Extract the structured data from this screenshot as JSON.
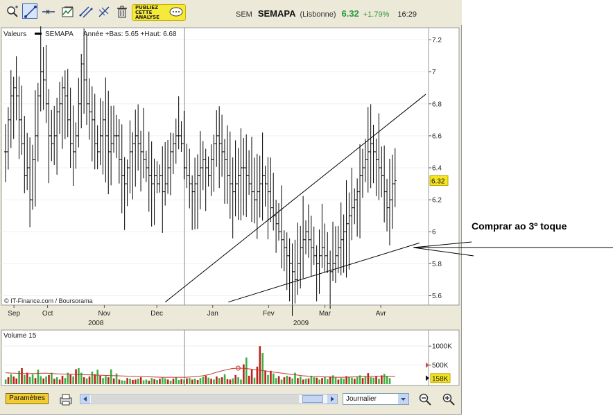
{
  "toolbar": {
    "tools": [
      {
        "name": "zoom-icon"
      },
      {
        "name": "trendline-icon"
      },
      {
        "name": "horizontal-line-icon"
      },
      {
        "name": "indicator-icon"
      },
      {
        "name": "channel-icon"
      },
      {
        "name": "fibonacci-icon"
      },
      {
        "name": "trash-icon"
      }
    ],
    "ad_text": "PUBLIEZ\nCETTE\nANALYSE"
  },
  "quote": {
    "market": "SEM",
    "name": "SEMAPA",
    "place": "(Lisbonne)",
    "price": "6.32",
    "change": "+1.79%",
    "time": "16:29"
  },
  "chart_data": [
    {
      "type": "ohlc",
      "header_label": "Valeurs",
      "legend_series": "SEMAPA",
      "legend_range": "Année +Bas: 5.65 +Haut: 6.68",
      "source": "© IT-Finance.com / Boursorama",
      "ylim": [
        5.55,
        7.25
      ],
      "yticks": [
        "5.6",
        "5.8",
        "6",
        "6.2",
        "6.4",
        "6.6",
        "6.8",
        "7",
        "7.2"
      ],
      "month_labels": [
        {
          "label": "Sep",
          "pos": 0.02
        },
        {
          "label": "Oct",
          "pos": 0.1
        },
        {
          "label": "Nov",
          "pos": 0.235
        },
        {
          "label": "Dec",
          "pos": 0.36
        },
        {
          "label": "Jan",
          "pos": 0.493
        },
        {
          "label": "Fev",
          "pos": 0.626
        },
        {
          "label": "Mar",
          "pos": 0.76
        },
        {
          "label": "Avr",
          "pos": 0.893
        }
      ],
      "year_labels": [
        {
          "label": "2008",
          "pos": 0.215
        },
        {
          "label": "2009",
          "pos": 0.703
        }
      ],
      "year_separator_pos": 0.426,
      "last_value_label": "6.32",
      "series_close": [
        6.5,
        6.7,
        6.85,
        6.9,
        6.85,
        6.7,
        6.55,
        6.35,
        6.4,
        6.2,
        6.45,
        6.6,
        6.85,
        7.0,
        6.95,
        6.8,
        6.6,
        6.55,
        6.6,
        6.75,
        6.8,
        6.9,
        6.85,
        6.7,
        6.55,
        6.5,
        6.6,
        6.8,
        7.05,
        6.95,
        6.8,
        6.75,
        6.7,
        6.55,
        6.5,
        6.6,
        6.7,
        6.6,
        6.5,
        6.55,
        6.6,
        6.6,
        6.45,
        6.35,
        6.3,
        6.4,
        6.5,
        6.55,
        6.6,
        6.55,
        6.5,
        6.45,
        6.4,
        6.35,
        6.3,
        6.35,
        6.3,
        6.35,
        6.25,
        6.3,
        6.4,
        6.5,
        6.55,
        6.6,
        6.6,
        6.55,
        6.4,
        6.35,
        6.3,
        6.25,
        6.3,
        6.35,
        6.4,
        6.45,
        6.4,
        6.35,
        6.45,
        6.55,
        6.6,
        6.55,
        6.5,
        6.45,
        6.35,
        6.3,
        6.25,
        6.3,
        6.35,
        6.4,
        6.4,
        6.35,
        6.3,
        6.25,
        6.2,
        6.25,
        6.3,
        6.35,
        6.3,
        6.25,
        6.15,
        6.1,
        6.05,
        6.0,
        5.95,
        5.9,
        5.85,
        5.8,
        5.75,
        5.7,
        5.8,
        5.9,
        5.95,
        6.0,
        5.95,
        5.9,
        5.85,
        5.8,
        5.85,
        5.9,
        5.85,
        5.8,
        5.75,
        5.8,
        5.85,
        5.9,
        5.95,
        6.0,
        6.05,
        6.1,
        6.15,
        6.2,
        6.25,
        6.35,
        6.4,
        6.45,
        6.5,
        6.55,
        6.5,
        6.45,
        6.4,
        6.35,
        6.25,
        6.15,
        6.2,
        6.3,
        6.32
      ],
      "trendlines": [
        {
          "from": [
            0.38,
            5.56
          ],
          "to": [
            1.0,
            6.86
          ]
        },
        {
          "from": [
            0.53,
            5.56
          ],
          "to": [
            0.985,
            5.93
          ]
        }
      ]
    },
    {
      "type": "bar",
      "header_label": "Volume 15",
      "ylim": [
        0,
        1350
      ],
      "yticks": [
        "1000K",
        "500K"
      ],
      "current_label": "158K",
      "marker_value": 500,
      "volumes": [
        120,
        180,
        260,
        200,
        150,
        350,
        420,
        240,
        300,
        190,
        260,
        160,
        380,
        210,
        150,
        200,
        240,
        300,
        140,
        180,
        120,
        220,
        160,
        300,
        250,
        200,
        390,
        420,
        300,
        180,
        150,
        200,
        330,
        260,
        380,
        220,
        160,
        210,
        180,
        390,
        150,
        280,
        120,
        100,
        90,
        160,
        140,
        110,
        120,
        140,
        180,
        100,
        120,
        90,
        160,
        130,
        110,
        140,
        170,
        150,
        120,
        90,
        140,
        180,
        110,
        130,
        120,
        150,
        160,
        120,
        140,
        110,
        160,
        190,
        220,
        170,
        140,
        120,
        200,
        160,
        180,
        260,
        130,
        120,
        150,
        240,
        180,
        120,
        520,
        700,
        220,
        380,
        170,
        460,
        1000,
        820,
        360,
        240,
        350,
        280,
        160,
        210,
        120,
        180,
        220,
        190,
        150,
        300,
        160,
        200,
        120,
        140,
        150,
        220,
        180,
        170,
        120,
        160,
        190,
        130,
        200,
        230,
        170,
        120,
        160,
        140,
        210,
        190,
        170,
        140,
        200,
        230,
        160,
        210,
        290,
        180,
        170,
        200,
        140,
        230,
        270,
        200,
        158
      ],
      "volume_colors_up": [
        1,
        0,
        1,
        0,
        0,
        1,
        0,
        1,
        0,
        1,
        1,
        0,
        1,
        1,
        0,
        1,
        0,
        1,
        0,
        1,
        0,
        0,
        1,
        1,
        0,
        1,
        0,
        1,
        1,
        0,
        1,
        0,
        1,
        0,
        1,
        0,
        1,
        1,
        0,
        1,
        0,
        1,
        0,
        1,
        1,
        0,
        1,
        0,
        0,
        1,
        0,
        1,
        1,
        0,
        1,
        0,
        1,
        0,
        1,
        1,
        0,
        1,
        0,
        1,
        1,
        0,
        1,
        0,
        1,
        0,
        1,
        0,
        1,
        1,
        0,
        1,
        0,
        1,
        0,
        1,
        0,
        1,
        0,
        0,
        1,
        0,
        1,
        1,
        0,
        1,
        0,
        0,
        1,
        0,
        0,
        1,
        0,
        1,
        0,
        1,
        1,
        0,
        1,
        0,
        1,
        0,
        1,
        1,
        0,
        1,
        0,
        1,
        0,
        1,
        1,
        0,
        1,
        0,
        1,
        1,
        0,
        1,
        1,
        0,
        1,
        1,
        0,
        1,
        1,
        0,
        1,
        1,
        0,
        1,
        0,
        1,
        1,
        0,
        1,
        0,
        1,
        1,
        1
      ],
      "moving_average": [
        300,
        290,
        285,
        280,
        275,
        280,
        285,
        290,
        280,
        270,
        265,
        260,
        255,
        250,
        245,
        240,
        235,
        230,
        225,
        220,
        215,
        210,
        205,
        200,
        195,
        190,
        185,
        180,
        180,
        180,
        180,
        180,
        190,
        200,
        220,
        250,
        300,
        340,
        380,
        410,
        420,
        415,
        400,
        380,
        360,
        340,
        320,
        300,
        280,
        260,
        240,
        220,
        210,
        200,
        195,
        190,
        185,
        180,
        180,
        185,
        190,
        195,
        200,
        205,
        210,
        210,
        205,
        200
      ]
    }
  ],
  "bottom": {
    "params_label": "Paramètres",
    "period_value": "Journalier"
  },
  "annotation": "Comprar ao 3º toque"
}
